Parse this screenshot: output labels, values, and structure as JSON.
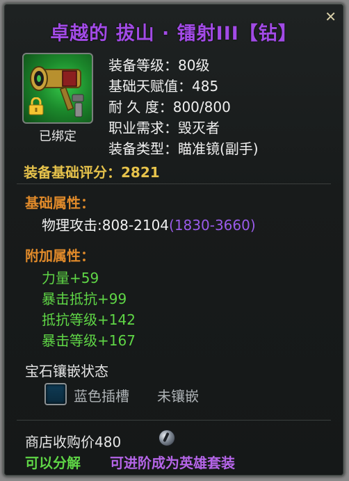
{
  "item": {
    "title": "卓越的 拔山 · 镭射III【钻】",
    "bound_label": "已绑定",
    "close_glyph": "✕"
  },
  "stats": {
    "level": "装备等级：80级",
    "base_talent": "基础天赋值：485",
    "durability": "耐 久 度：800/800",
    "class_req": "职业需求：毁灭者",
    "type": "装备类型：瞄准镜(副手)",
    "score": "装备基础评分：2821"
  },
  "base_attributes": {
    "title": "基础属性：",
    "attack_label": "物理攻击:808-2104",
    "attack_range": "(1830-3660)"
  },
  "extra_attributes": {
    "title": "附加属性：",
    "items": [
      "力量+59",
      "暴击抵抗+99",
      "抵抗等级+142",
      "暴击等级+167"
    ]
  },
  "gem": {
    "title": "宝石镶嵌状态",
    "slot_label": "蓝色插槽",
    "status": "未镶嵌"
  },
  "footer": {
    "shop_price": "商店收购价480",
    "coin_icon": "silver-coin-icon",
    "decompose": "可以分解",
    "upgrade": "可进阶成为英雄套装"
  },
  "colors": {
    "title": "#a24be6",
    "score": "#e6c24b",
    "section": "#e08a2a",
    "green": "#5fd646",
    "purple": "#9a5bea"
  }
}
